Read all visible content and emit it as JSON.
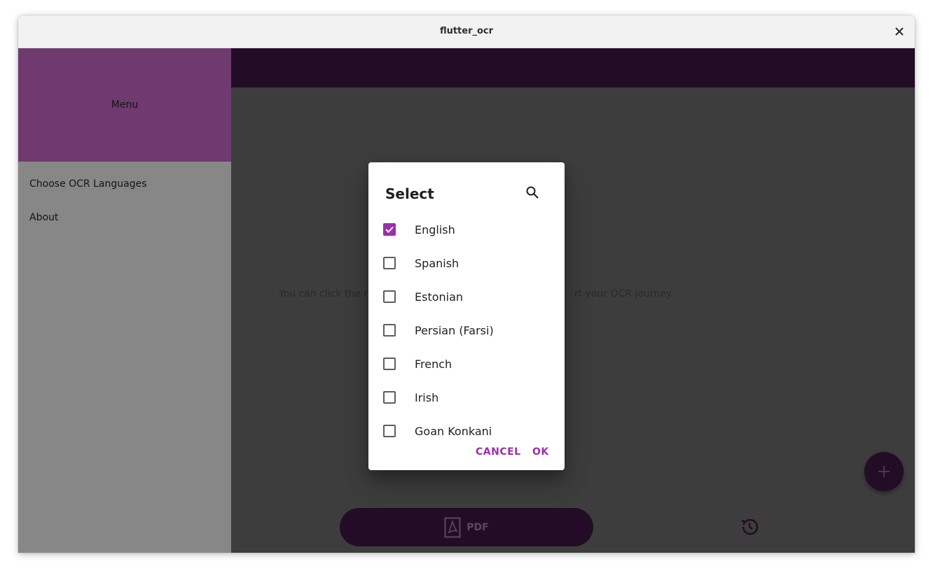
{
  "window": {
    "title": "flutter_ocr",
    "close_icon": "close-icon"
  },
  "drawer": {
    "header": "Menu",
    "items": [
      {
        "label": "Choose OCR Languages"
      },
      {
        "label": "About"
      }
    ]
  },
  "main": {
    "hint_left": "You can click the rig",
    "hint_right": "rt your OCR journey."
  },
  "bottom": {
    "pdf_label": "PDF",
    "pdf_icon": "pdf-file-icon",
    "history_icon": "history-icon",
    "fab_icon": "plus-icon"
  },
  "dialog": {
    "title": "Select",
    "search_icon": "search-icon",
    "options": [
      {
        "label": "English",
        "checked": true
      },
      {
        "label": "Spanish",
        "checked": false
      },
      {
        "label": "Estonian",
        "checked": false
      },
      {
        "label": "Persian (Farsi)",
        "checked": false
      },
      {
        "label": "French",
        "checked": false
      },
      {
        "label": "Irish",
        "checked": false
      },
      {
        "label": "Goan Konkani",
        "checked": false
      }
    ],
    "cancel_label": "CANCEL",
    "ok_label": "OK"
  },
  "colors": {
    "accent": "#9b2fae",
    "appbar": "#230c25",
    "drawer_header": "#6e3a70"
  }
}
